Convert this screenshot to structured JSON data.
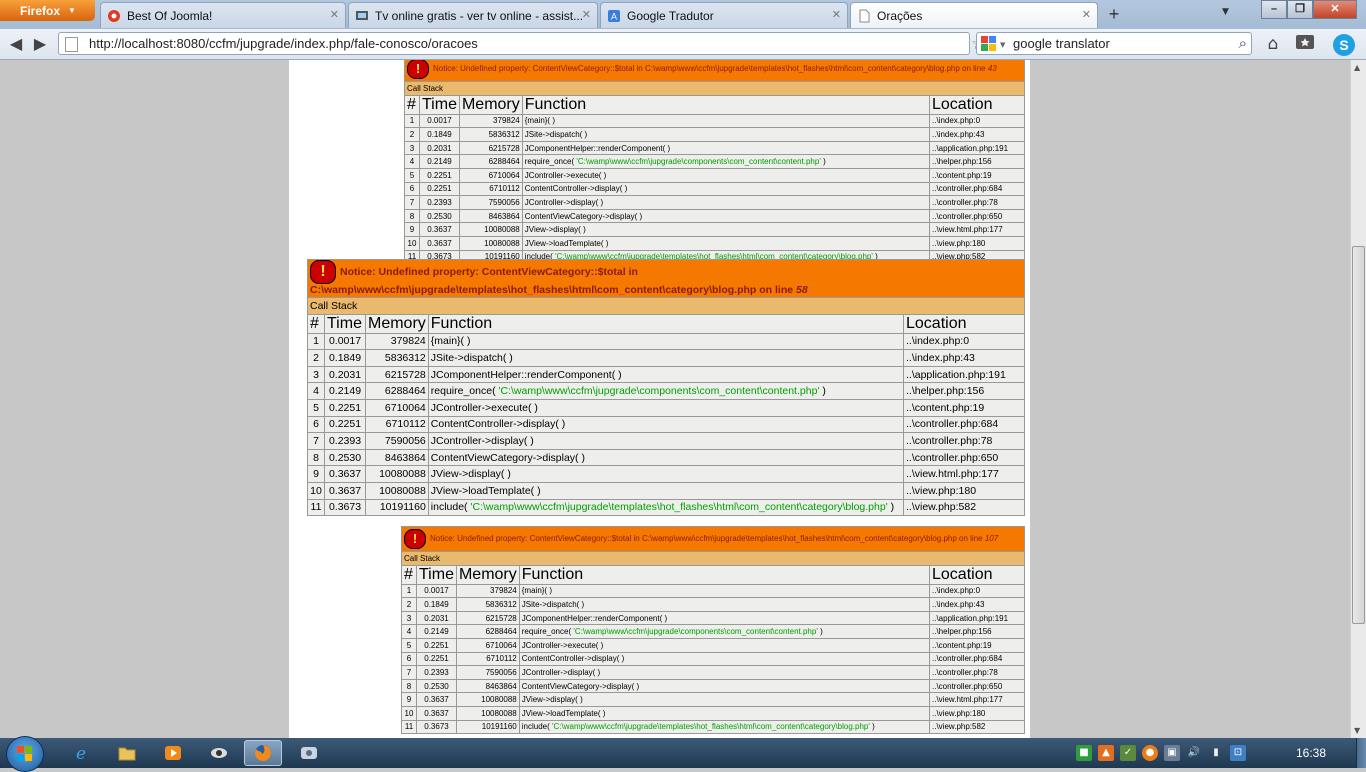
{
  "browser": {
    "menu_button": "Firefox",
    "tabs": [
      {
        "title": "Best Of Joomla!",
        "active": false
      },
      {
        "title": "Tv online gratis - ver tv online - assist...",
        "active": false
      },
      {
        "title": "Google Tradutor",
        "active": false
      },
      {
        "title": "Orações",
        "active": true
      }
    ],
    "new_tab": "+",
    "url": "http://localhost:8080/ccfm/jupgrade/index.php/fale-conosco/oracoes",
    "search": "google translator"
  },
  "page": {
    "errors": [
      {
        "message": "Notice: Undefined property: ContentViewCategory::$total in C:\\wamp\\www\\ccfm\\jupgrade\\templates\\hot_flashes\\html\\com_content\\category\\blog.php on line ",
        "line": "43"
      },
      {
        "message": "Notice: Undefined property: ContentViewCategory::$total in C:\\wamp\\www\\ccfm\\jupgrade\\templates\\hot_flashes\\html\\com_content\\category\\blog.php on line ",
        "line": "58"
      },
      {
        "message": "Notice: Undefined property: ContentViewCategory::$total in C:\\wamp\\www\\ccfm\\jupgrade\\templates\\hot_flashes\\html\\com_content\\category\\blog.php on line ",
        "line": "107"
      }
    ],
    "call_stack_label": "Call Stack",
    "columns": [
      "#",
      "Time",
      "Memory",
      "Function",
      "Location"
    ],
    "rows": [
      {
        "n": "1",
        "time": "0.0017",
        "mem": "379824",
        "fn": "{main}( )",
        "arg": "",
        "fn_end": "",
        "loc": "..\\index.php:0"
      },
      {
        "n": "2",
        "time": "0.1849",
        "mem": "5836312",
        "fn": "JSite->dispatch( )",
        "arg": "",
        "fn_end": "",
        "loc": "..\\index.php:43"
      },
      {
        "n": "3",
        "time": "0.2031",
        "mem": "6215728",
        "fn": "JComponentHelper::renderComponent( )",
        "arg": "",
        "fn_end": "",
        "loc": "..\\application.php:191"
      },
      {
        "n": "4",
        "time": "0.2149",
        "mem": "6288464",
        "fn": "require_once( ",
        "arg": "'C:\\wamp\\www\\ccfm\\jupgrade\\components\\com_content\\content.php'",
        "fn_end": " )",
        "loc": "..\\helper.php:156"
      },
      {
        "n": "5",
        "time": "0.2251",
        "mem": "6710064",
        "fn": "JController->execute( )",
        "arg": "",
        "fn_end": "",
        "loc": "..\\content.php:19"
      },
      {
        "n": "6",
        "time": "0.2251",
        "mem": "6710112",
        "fn": "ContentController->display( )",
        "arg": "",
        "fn_end": "",
        "loc": "..\\controller.php:684"
      },
      {
        "n": "7",
        "time": "0.2393",
        "mem": "7590056",
        "fn": "JController->display( )",
        "arg": "",
        "fn_end": "",
        "loc": "..\\controller.php:78"
      },
      {
        "n": "8",
        "time": "0.2530",
        "mem": "8463864",
        "fn": "ContentViewCategory->display( )",
        "arg": "",
        "fn_end": "",
        "loc": "..\\controller.php:650"
      },
      {
        "n": "9",
        "time": "0.3637",
        "mem": "10080088",
        "fn": "JView->display( )",
        "arg": "",
        "fn_end": "",
        "loc": "..\\view.html.php:177"
      },
      {
        "n": "10",
        "time": "0.3637",
        "mem": "10080088",
        "fn": "JView->loadTemplate( )",
        "arg": "",
        "fn_end": "",
        "loc": "..\\view.php:180"
      },
      {
        "n": "11",
        "time": "0.3673",
        "mem": "10191160",
        "fn": "include( ",
        "arg": "'C:\\wamp\\www\\ccfm\\jupgrade\\templates\\hot_flashes\\html\\com_content\\category\\blog.php'",
        "fn_end": " )",
        "loc": "..\\view.php:582"
      }
    ]
  },
  "taskbar": {
    "clock": "16:38",
    "icons": [
      "windows-start",
      "internet-explorer",
      "file-explorer",
      "media-player",
      "app",
      "firefox",
      "app2"
    ]
  },
  "colors": {
    "error_header": "#f57900",
    "call_stack_bg": "#e9b96e",
    "cell_bg": "#eeeeec",
    "string_arg": "#00a000"
  }
}
